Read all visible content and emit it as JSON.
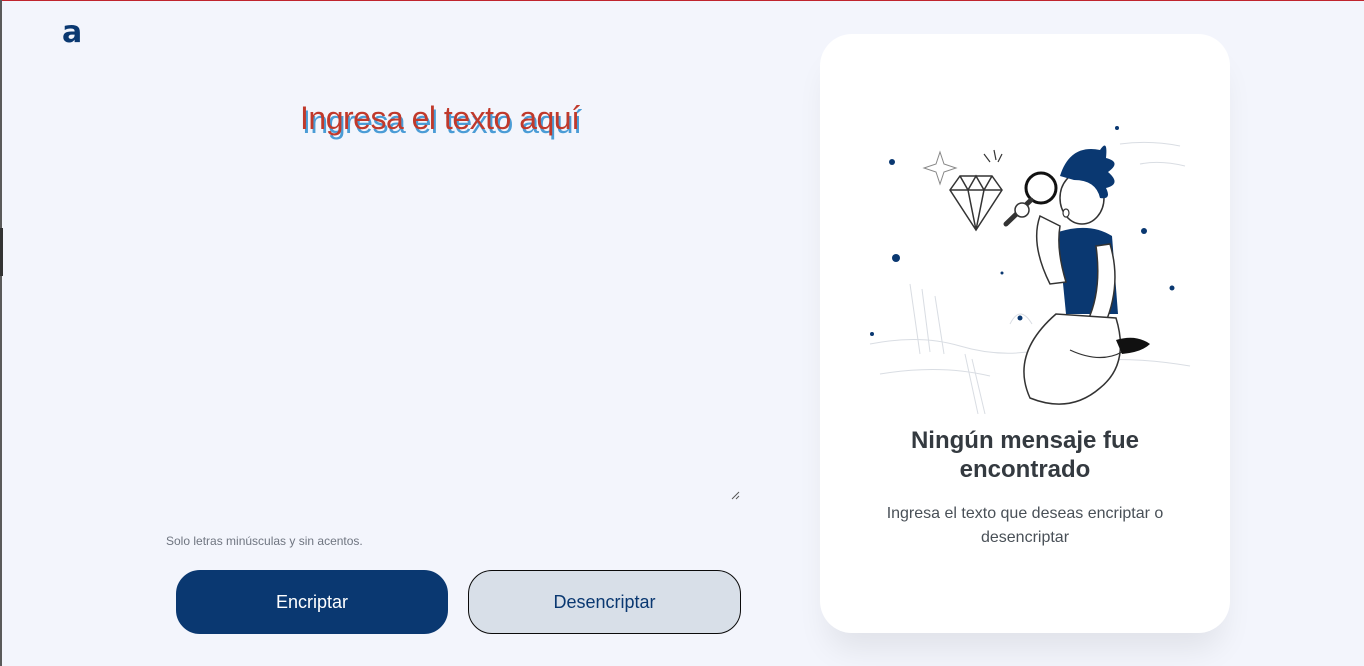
{
  "logo": {
    "text": "a"
  },
  "input": {
    "placeholder": "Ingresa el texto aquí",
    "value": ""
  },
  "hint": "Solo letras minúsculas y sin acentos.",
  "buttons": {
    "encrypt_label": "Encriptar",
    "decrypt_label": "Desencriptar"
  },
  "output": {
    "title": "Ningún mensaje fue encontrado",
    "message": "Ingresa el texto que deseas encriptar o desencriptar"
  },
  "colors": {
    "background": "#f3f5fc",
    "primary": "#0a3871",
    "secondary": "#d8dfe8",
    "placeholder_text": "#c0392b",
    "placeholder_shadow": "#4a9cd6",
    "card": "#ffffff"
  },
  "icons": {
    "illustration": "person-with-magnifying-glass-and-diamond"
  }
}
